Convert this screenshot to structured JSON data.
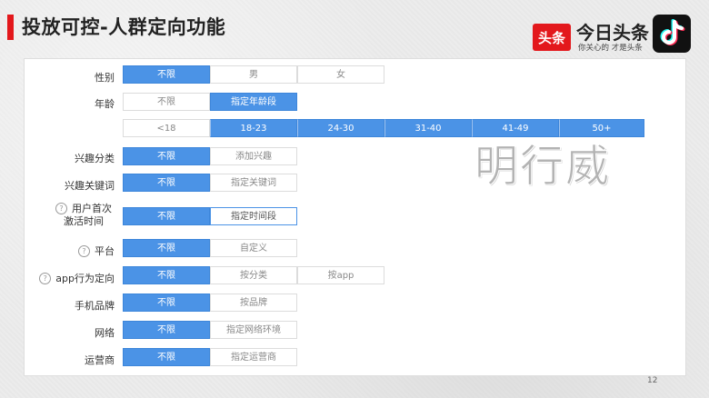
{
  "slide": {
    "title": "投放可控-人群定向功能",
    "page_number": "12",
    "watermark": "明行威"
  },
  "brand": {
    "toutiao_logo_text": "头条",
    "toutiao_name": "今日头条",
    "toutiao_slogan": "你关心的 才是头条",
    "accent_color": "#e3181c",
    "option_selected_color": "#4b93e6"
  },
  "targeting": {
    "gender": {
      "label": "性别",
      "options": [
        "不限",
        "男",
        "女"
      ],
      "selected": "不限"
    },
    "age": {
      "label": "年龄",
      "options": [
        "不限",
        "指定年龄段"
      ],
      "selected": "指定年龄段",
      "ranges": [
        "<18",
        "18-23",
        "24-30",
        "31-40",
        "41-49",
        "50+"
      ],
      "selected_ranges": [
        "18-23",
        "24-30",
        "31-40",
        "41-49",
        "50+"
      ]
    },
    "interest_category": {
      "label": "兴趣分类",
      "options": [
        "不限",
        "添加兴趣"
      ],
      "selected": "不限"
    },
    "interest_keywords": {
      "label": "兴趣关键词",
      "options": [
        "不限",
        "指定关键词"
      ],
      "selected": "不限"
    },
    "first_activation": {
      "label_line1": "用户首次",
      "label_line2": "激活时间",
      "options": [
        "不限",
        "指定时间段"
      ],
      "selected": "不限"
    },
    "platform": {
      "label": "平台",
      "options": [
        "不限",
        "自定义"
      ],
      "selected": "不限"
    },
    "app_behavior": {
      "label": "app行为定向",
      "options": [
        "不限",
        "按分类",
        "按app"
      ],
      "selected": "不限"
    },
    "phone_brand": {
      "label": "手机品牌",
      "options": [
        "不限",
        "按品牌"
      ],
      "selected": "不限"
    },
    "network": {
      "label": "网络",
      "options": [
        "不限",
        "指定网络环境"
      ],
      "selected": "不限"
    },
    "carrier": {
      "label": "运营商",
      "options": [
        "不限",
        "指定运营商"
      ],
      "selected": "不限"
    }
  }
}
